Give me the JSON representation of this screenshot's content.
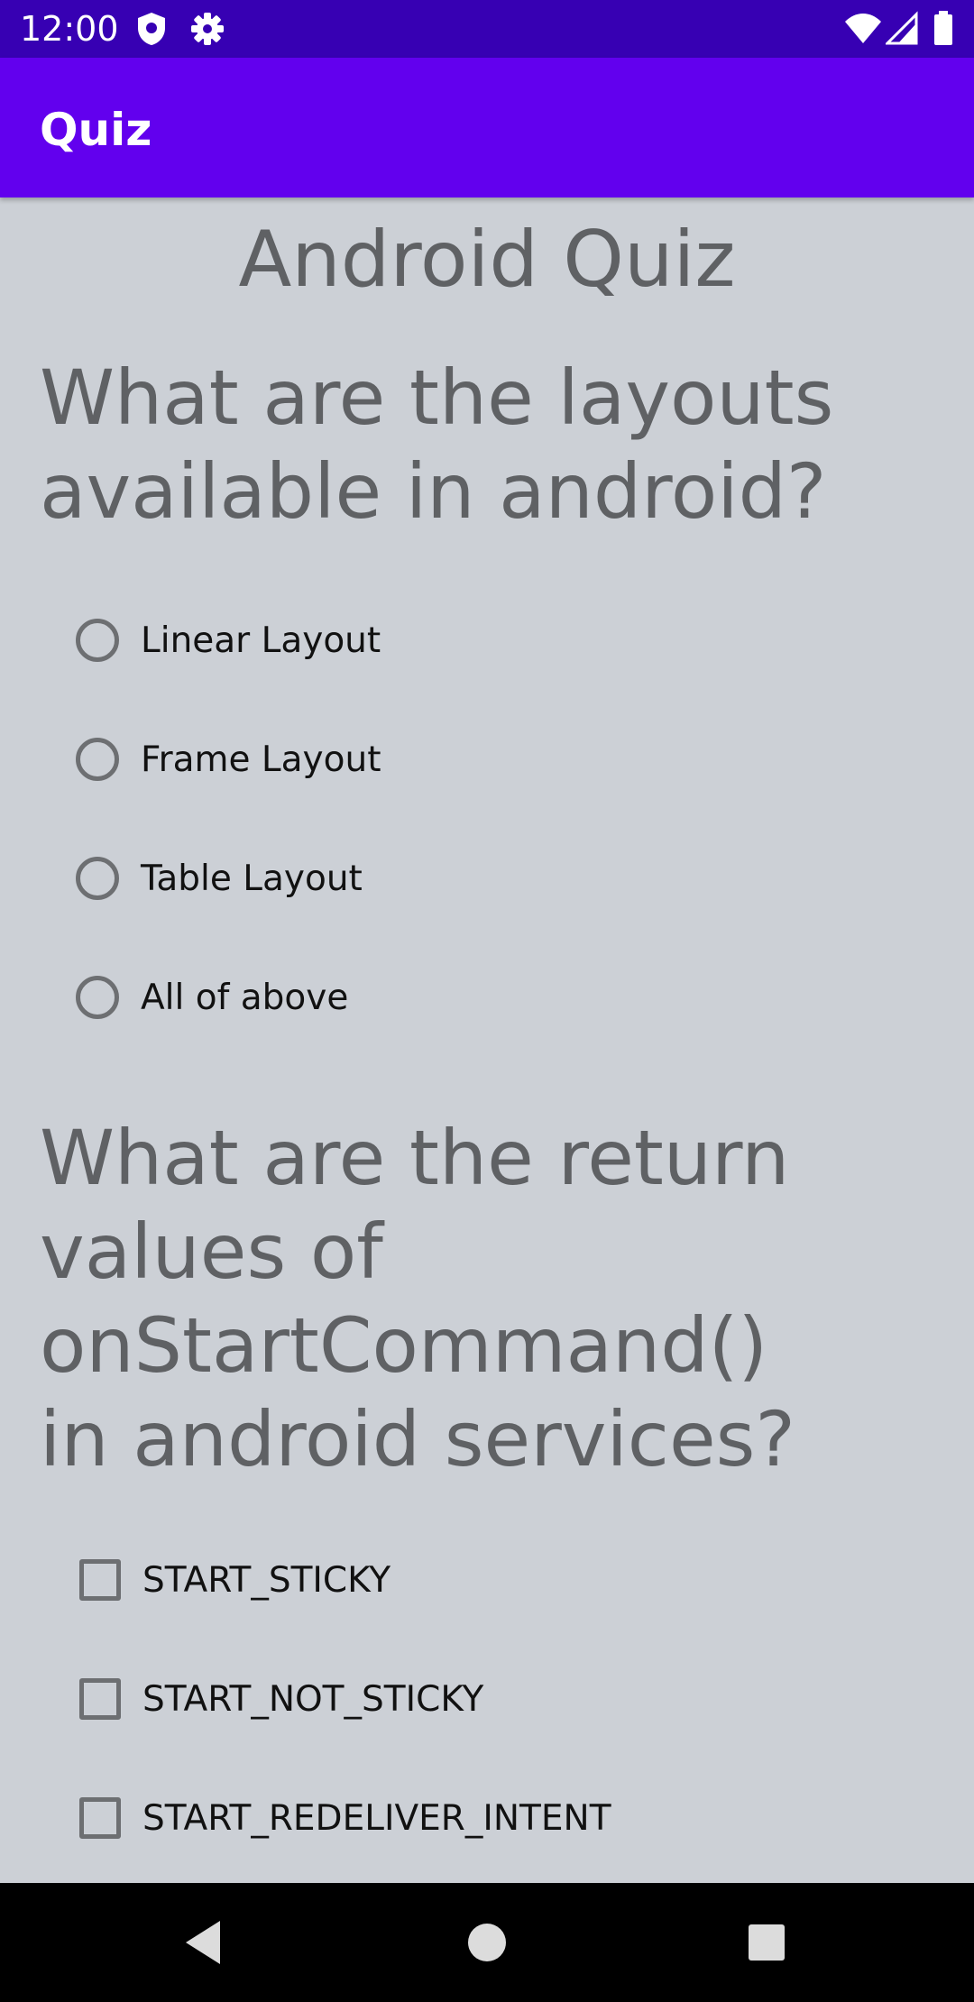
{
  "status_bar": {
    "time": "12:00",
    "icons_left": [
      "shield-icon",
      "gear-icon"
    ],
    "icons_right": [
      "wifi-icon",
      "cell-signal-icon",
      "battery-icon"
    ]
  },
  "app_bar": {
    "title": "Quiz",
    "color": "#6200ee"
  },
  "main": {
    "heading": "Android Quiz",
    "questions": [
      {
        "text": "What are the layouts available in android?",
        "type": "radio",
        "options": [
          "Linear Layout",
          "Frame Layout",
          "Table Layout",
          "All of above"
        ]
      },
      {
        "text": "What are the return values of onStartCommand() in android services?",
        "type": "checkbox",
        "options": [
          "START_STICKY",
          "START_NOT_STICKY",
          "START_REDELIVER_INTENT"
        ]
      }
    ]
  },
  "nav_bar": {
    "buttons": [
      "back-icon",
      "home-icon",
      "recents-icon"
    ]
  },
  "colors": {
    "status_bar": "#3700b3",
    "app_bar": "#6200ee",
    "background": "#ccd0d6",
    "text_muted": "#5f6164"
  }
}
